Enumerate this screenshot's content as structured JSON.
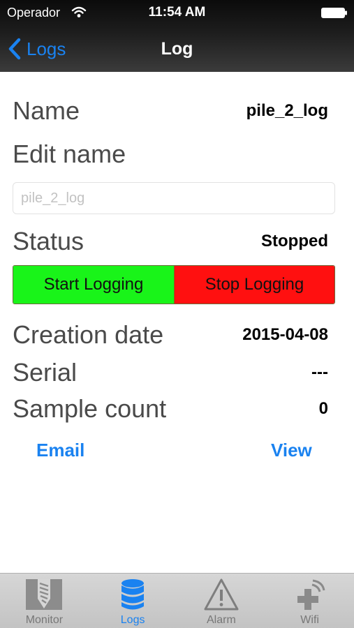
{
  "status_bar": {
    "carrier": "Operador",
    "time": "11:54 AM",
    "icons": [
      "wifi-icon",
      "battery-icon"
    ]
  },
  "nav": {
    "back_label": "Logs",
    "title": "Log"
  },
  "details": {
    "name_label": "Name",
    "name_value": "pile_2_log",
    "edit_name_label": "Edit name",
    "name_input": {
      "value": "",
      "placeholder": "pile_2_log"
    },
    "status_label": "Status",
    "status_value": "Stopped",
    "start_button": "Start Logging",
    "stop_button": "Stop Logging",
    "creation_date_label": "Creation date",
    "creation_date_value": "2015-04-08",
    "serial_label": "Serial",
    "serial_value": "---",
    "sample_count_label": "Sample count",
    "sample_count_value": "0"
  },
  "actions": {
    "email": "Email",
    "view": "View"
  },
  "tab_bar": {
    "active": "Logs",
    "tabs": [
      {
        "label": "Monitor",
        "icon": "monitor-icon"
      },
      {
        "label": "Logs",
        "icon": "database-icon"
      },
      {
        "label": "Alarm",
        "icon": "warning-icon"
      },
      {
        "label": "Wifi",
        "icon": "wifi-plus-icon"
      }
    ]
  },
  "colors": {
    "accent": "#1a82f0",
    "start": "#19f419",
    "stop": "#ff1010"
  }
}
